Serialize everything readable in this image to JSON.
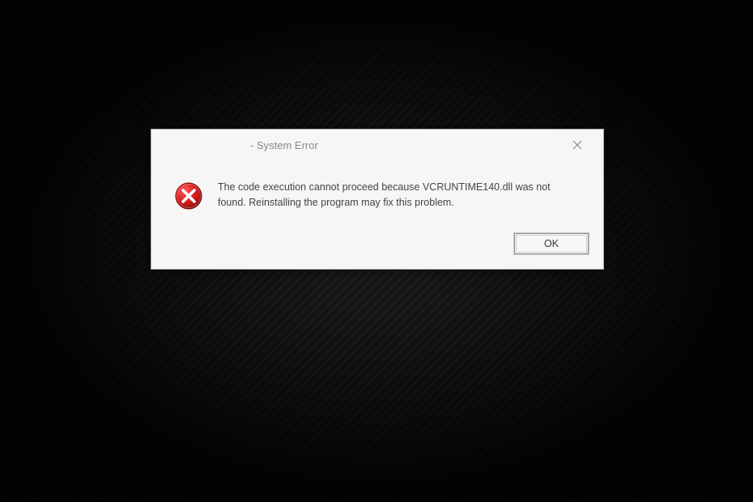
{
  "dialog": {
    "title": "- System Error",
    "message": "The code execution cannot proceed because VCRUNTIME140.dll was not found. Reinstalling the program may fix this problem.",
    "ok_label": "OK"
  }
}
